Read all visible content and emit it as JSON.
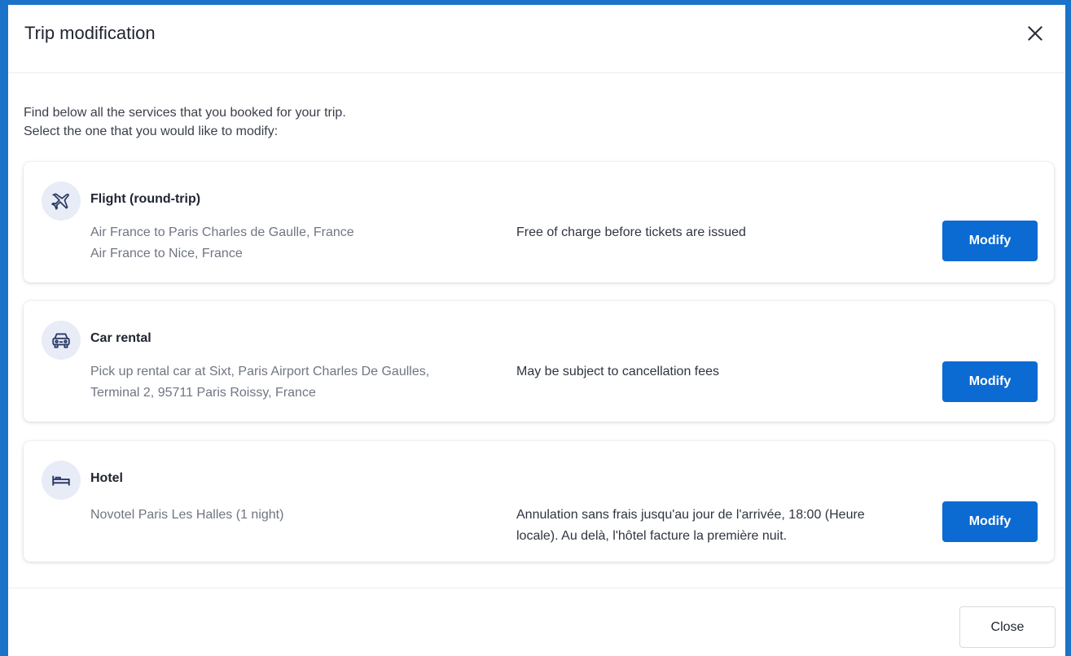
{
  "dialog": {
    "title": "Trip modification",
    "intro_line1": "Find below all the services that you booked for your trip.",
    "intro_line2": "Select the one that you would like to modify:"
  },
  "services": [
    {
      "icon": "airplane-icon",
      "title": "Flight (round-trip)",
      "desc_line1": "Air France to Paris Charles de Gaulle, France",
      "desc_line2": "Air France to Nice, France",
      "policy_line1": "Free of charge before tickets are issued",
      "policy_line2": "",
      "button": "Modify"
    },
    {
      "icon": "car-icon",
      "title": "Car rental",
      "desc_line1": "Pick up rental car at Sixt, Paris Airport Charles De Gaulles,",
      "desc_line2": "Terminal 2, 95711 Paris Roissy, France",
      "policy_line1": "May be subject to cancellation fees",
      "policy_line2": "",
      "button": "Modify"
    },
    {
      "icon": "bed-icon",
      "title": "Hotel",
      "desc_line1": "Novotel Paris Les Halles (1 night)",
      "desc_line2": "",
      "policy_line1": "Annulation sans frais jusqu'au jour de l'arrivée, 18:00 (Heure",
      "policy_line2": "locale). Au delà, l'hôtel facture la première nuit.",
      "button": "Modify"
    }
  ],
  "footer": {
    "close_label": "Close"
  },
  "colors": {
    "primary": "#0b6bd3",
    "icon_bg": "#e8ecf7",
    "frame": "#1a73c8"
  }
}
